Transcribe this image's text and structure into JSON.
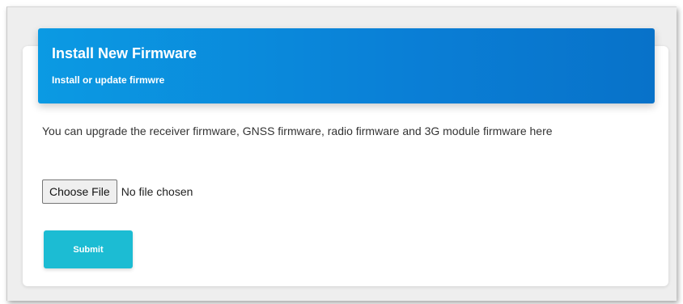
{
  "card": {
    "title": "Install New Firmware",
    "subtitle": "Install or update firmwre"
  },
  "description": "You can upgrade the receiver firmware, GNSS firmware, radio firmware and 3G module firmware here",
  "file_input": {
    "button_label": "Choose File",
    "status": "No file chosen"
  },
  "submit_label": "Submit",
  "colors": {
    "header_gradient_start": "#0b9ae3",
    "header_gradient_end": "#0872c9",
    "submit_button": "#1cbcd3"
  }
}
